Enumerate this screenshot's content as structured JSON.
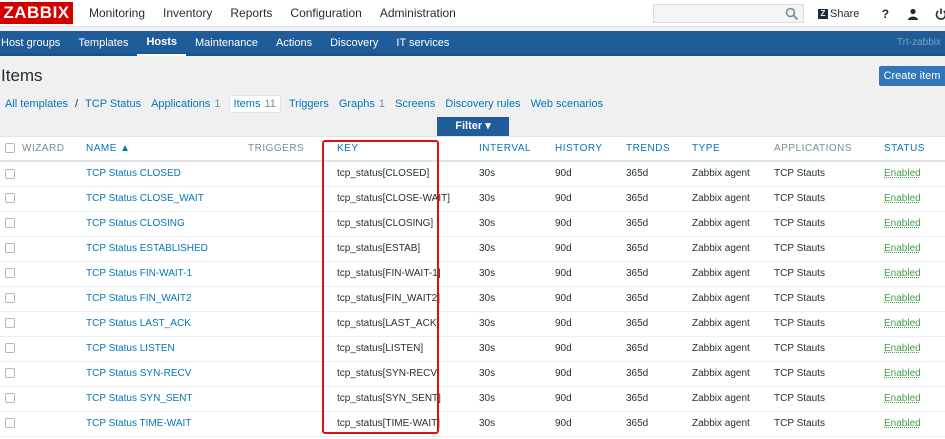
{
  "header": {
    "logo": "ZABBIX",
    "menu": [
      "Monitoring",
      "Inventory",
      "Reports",
      "Configuration",
      "Administration"
    ],
    "active_menu": "Configuration",
    "share_label": "Share",
    "help_label": "?",
    "search_value": ""
  },
  "submenu": {
    "items": [
      "Host groups",
      "Templates",
      "Hosts",
      "Maintenance",
      "Actions",
      "Discovery",
      "IT services"
    ],
    "active": "Hosts",
    "right_text": "Trt-zabbix"
  },
  "page": {
    "title": "Items",
    "create_button": "Create item",
    "filter_label": "Filter ▾"
  },
  "breadcrumbs": {
    "all_templates": "All templates",
    "separator": "/",
    "template": "TCP Status",
    "applications": "Applications",
    "applications_count": "1",
    "items": "Items",
    "items_count": "11",
    "triggers": "Triggers",
    "graphs": "Graphs",
    "graphs_count": "1",
    "screens": "Screens",
    "discovery_rules": "Discovery rules",
    "web_scenarios": "Web scenarios"
  },
  "table": {
    "columns": [
      "WIZARD",
      "NAME ▲",
      "TRIGGERS",
      "KEY",
      "INTERVAL",
      "HISTORY",
      "TRENDS",
      "TYPE",
      "APPLICATIONS",
      "STATUS"
    ],
    "rows": [
      {
        "name": "TCP Status CLOSED",
        "key": "tcp_status[CLOSED]",
        "interval": "30s",
        "history": "90d",
        "trends": "365d",
        "type": "Zabbix agent",
        "applications": "TCP Stauts",
        "status": "Enabled"
      },
      {
        "name": "TCP Status CLOSE_WAIT",
        "key": "tcp_status[CLOSE-WAIT]",
        "interval": "30s",
        "history": "90d",
        "trends": "365d",
        "type": "Zabbix agent",
        "applications": "TCP Stauts",
        "status": "Enabled"
      },
      {
        "name": "TCP Status CLOSING",
        "key": "tcp_status[CLOSING]",
        "interval": "30s",
        "history": "90d",
        "trends": "365d",
        "type": "Zabbix agent",
        "applications": "TCP Stauts",
        "status": "Enabled"
      },
      {
        "name": "TCP Status ESTABLISHED",
        "key": "tcp_status[ESTAB]",
        "interval": "30s",
        "history": "90d",
        "trends": "365d",
        "type": "Zabbix agent",
        "applications": "TCP Stauts",
        "status": "Enabled"
      },
      {
        "name": "TCP Status FIN-WAIT-1",
        "key": "tcp_status[FIN-WAIT-1]",
        "interval": "30s",
        "history": "90d",
        "trends": "365d",
        "type": "Zabbix agent",
        "applications": "TCP Stauts",
        "status": "Enabled"
      },
      {
        "name": "TCP Status FIN_WAIT2",
        "key": "tcp_status[FIN_WAIT2]",
        "interval": "30s",
        "history": "90d",
        "trends": "365d",
        "type": "Zabbix agent",
        "applications": "TCP Stauts",
        "status": "Enabled"
      },
      {
        "name": "TCP Status LAST_ACK",
        "key": "tcp_status[LAST_ACK]",
        "interval": "30s",
        "history": "90d",
        "trends": "365d",
        "type": "Zabbix agent",
        "applications": "TCP Stauts",
        "status": "Enabled"
      },
      {
        "name": "TCP Status LISTEN",
        "key": "tcp_status[LISTEN]",
        "interval": "30s",
        "history": "90d",
        "trends": "365d",
        "type": "Zabbix agent",
        "applications": "TCP Stauts",
        "status": "Enabled"
      },
      {
        "name": "TCP Status SYN-RECV",
        "key": "tcp_status[SYN-RECV]",
        "interval": "30s",
        "history": "90d",
        "trends": "365d",
        "type": "Zabbix agent",
        "applications": "TCP Stauts",
        "status": "Enabled"
      },
      {
        "name": "TCP Status SYN_SENT",
        "key": "tcp_status[SYN_SENT]",
        "interval": "30s",
        "history": "90d",
        "trends": "365d",
        "type": "Zabbix agent",
        "applications": "TCP Stauts",
        "status": "Enabled"
      },
      {
        "name": "TCP Status TIME-WAIT",
        "key": "tcp_status[TIME-WAIT]",
        "interval": "30s",
        "history": "90d",
        "trends": "365d",
        "type": "Zabbix agent",
        "applications": "TCP Stauts",
        "status": "Enabled"
      }
    ]
  },
  "colors": {
    "brand": "#d40000",
    "nav": "#1f5c99",
    "link": "#0275b8",
    "enabled": "#429e47",
    "highlight_box": "#e01010"
  },
  "icons": [
    "search-icon",
    "share-icon",
    "help-icon",
    "user-icon",
    "power-icon"
  ]
}
